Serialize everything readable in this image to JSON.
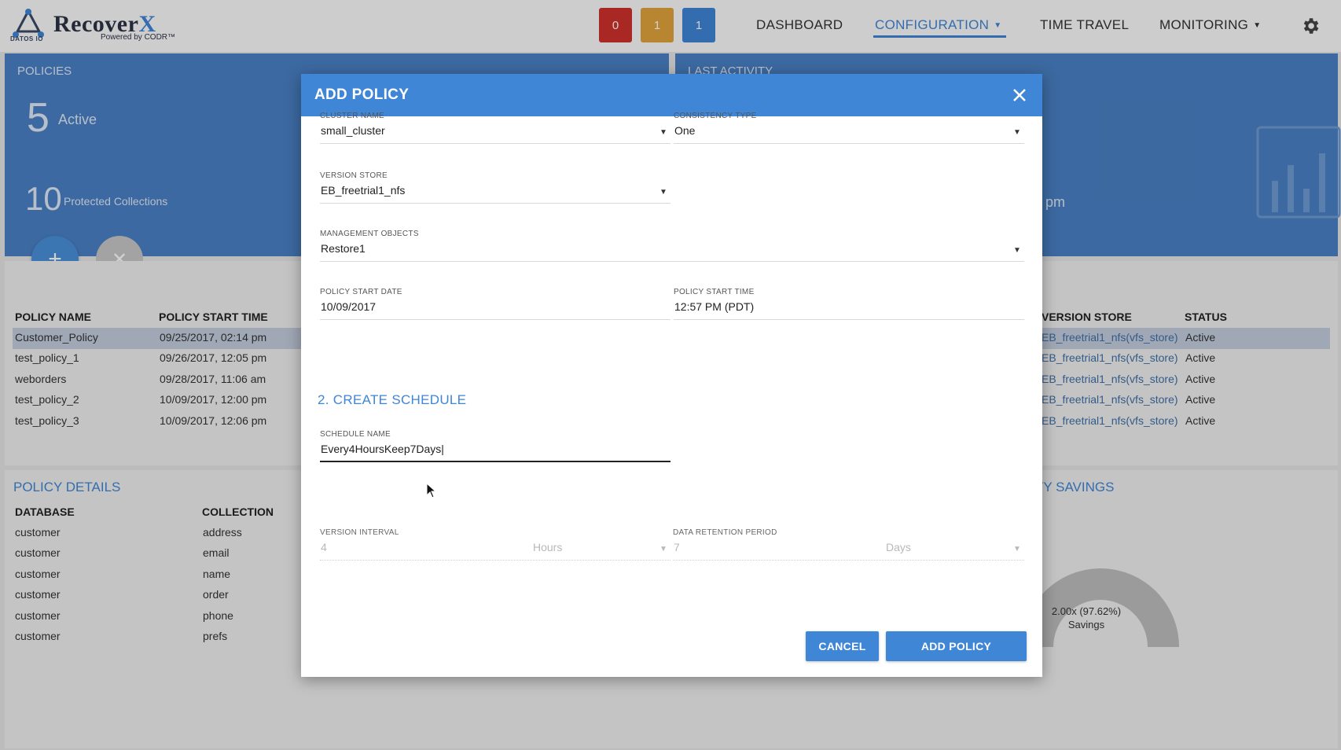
{
  "header": {
    "brand_main": "Recover",
    "brand_x": "X",
    "brand_sub": "Powered by CODR™",
    "logo_text": "DATOS IO",
    "alerts": {
      "critical": "0",
      "warning": "1",
      "info": "1"
    },
    "nav": {
      "dashboard": "DASHBOARD",
      "configuration": "CONFIGURATION",
      "time_travel": "TIME TRAVEL",
      "monitoring": "MONITORING"
    },
    "colors": {
      "accent": "#3f86d6",
      "critical": "#d0312d",
      "warning": "#e1a43b"
    }
  },
  "policies_panel": {
    "title": "POLICIES",
    "active_count": "5",
    "active_label": "Active",
    "protected_count": "10",
    "protected_label": "Protected Collections"
  },
  "last_activity_panel": {
    "title": "LAST ACTIVITY",
    "time_fragment": "pm"
  },
  "policy_table": {
    "headers": {
      "name": "POLICY NAME",
      "start": "POLICY START TIME",
      "store": "VERSION STORE",
      "status": "STATUS"
    },
    "rows": [
      {
        "name": "Customer_Policy",
        "start": "09/25/2017, 02:14 pm",
        "store": "EB_freetrial1_nfs(vfs_store)",
        "status": "Active"
      },
      {
        "name": "test_policy_1",
        "start": "09/26/2017, 12:05 pm",
        "store": "EB_freetrial1_nfs(vfs_store)",
        "status": "Active"
      },
      {
        "name": "weborders",
        "start": "09/28/2017, 11:06 am",
        "store": "EB_freetrial1_nfs(vfs_store)",
        "status": "Active"
      },
      {
        "name": "test_policy_2",
        "start": "10/09/2017, 12:00 pm",
        "store": "EB_freetrial1_nfs(vfs_store)",
        "status": "Active"
      },
      {
        "name": "test_policy_3",
        "start": "10/09/2017, 12:06 pm",
        "store": "EB_freetrial1_nfs(vfs_store)",
        "status": "Active"
      }
    ]
  },
  "policy_details": {
    "title": "POLICY DETAILS",
    "headers": {
      "database": "DATABASE",
      "collection": "COLLECTION"
    },
    "rows": [
      {
        "database": "customer",
        "collection": "address"
      },
      {
        "database": "customer",
        "collection": "email"
      },
      {
        "database": "customer",
        "collection": "name"
      },
      {
        "database": "customer",
        "collection": "order"
      },
      {
        "database": "customer",
        "collection": "phone"
      },
      {
        "database": "customer",
        "collection": "prefs"
      }
    ]
  },
  "capacity_savings": {
    "title": "CITY SAVINGS",
    "value": "2.00x (97.62%)",
    "label": "Savings"
  },
  "modal": {
    "title": "ADD POLICY",
    "fields": {
      "cluster_name": {
        "label": "CLUSTER NAME",
        "value": "small_cluster"
      },
      "consistency_type": {
        "label": "CONSISTENCY TYPE",
        "value": "One"
      },
      "version_store": {
        "label": "VERSION STORE",
        "value": "EB_freetrial1_nfs"
      },
      "management_objects": {
        "label": "MANAGEMENT OBJECTS",
        "value": "Restore1"
      },
      "policy_start_date": {
        "label": "POLICY START DATE",
        "value": "10/09/2017"
      },
      "policy_start_time": {
        "label": "POLICY START TIME",
        "value": "12:57 PM (PDT)"
      },
      "schedule_name": {
        "label": "SCHEDULE NAME",
        "value": "Every4HoursKeep7Days|"
      },
      "version_interval": {
        "label": "VERSION INTERVAL",
        "value": "4",
        "unit": "Hours"
      },
      "data_retention_period": {
        "label": "DATA RETENTION PERIOD",
        "value": "7",
        "unit": "Days"
      }
    },
    "section_create_schedule": "2. CREATE SCHEDULE",
    "buttons": {
      "cancel": "CANCEL",
      "add_policy": "ADD POLICY"
    }
  }
}
